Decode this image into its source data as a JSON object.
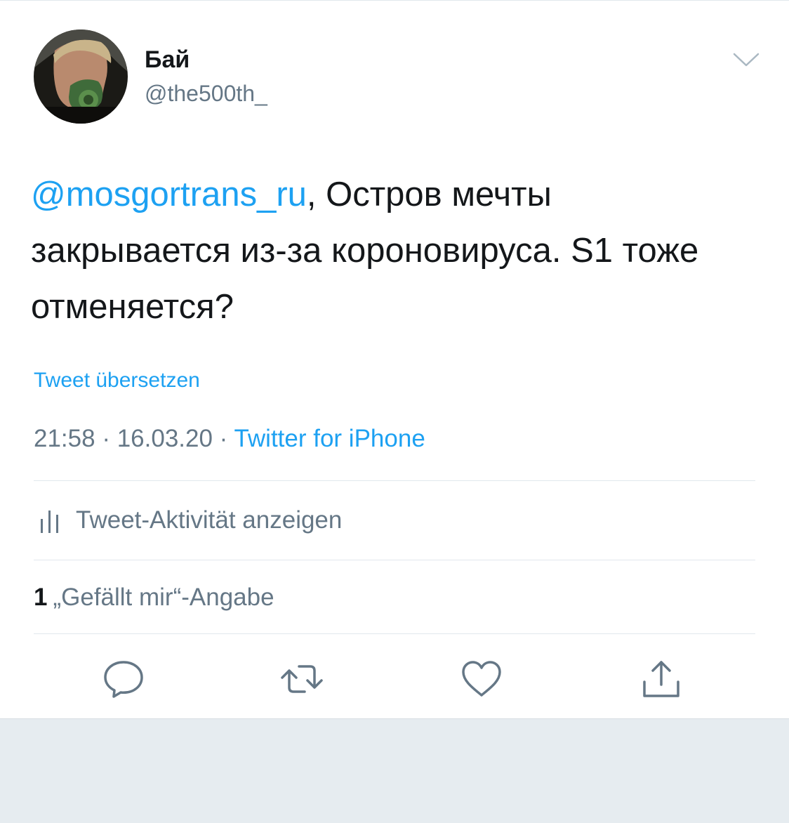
{
  "tweet": {
    "display_name": "Бай",
    "handle": "@the500th_",
    "mention": "@mosgortrans_ru",
    "text_after_mention": ", Остров мечты закрывается из-за короновируса. S1 тоже отменяется?",
    "translate_label": "Tweet übersetzen",
    "time": "21:58",
    "separator": " · ",
    "date": "16.03.20",
    "source": "Twitter for iPhone",
    "activity_label": "Tweet-Aktivität anzeigen",
    "like_count": "1",
    "like_label": "„Gefällt mir“-Angabe"
  },
  "icons": {
    "menu": "chevron-down-icon",
    "activity": "bar-chart-icon",
    "reply": "speech-bubble-icon",
    "retweet": "retweet-icon",
    "like": "heart-icon",
    "share": "share-icon"
  },
  "colors": {
    "link": "#1da1f2",
    "secondary_text": "#657786",
    "primary_text": "#14171a",
    "icon": "#657786",
    "background": "#e6ecf0"
  }
}
